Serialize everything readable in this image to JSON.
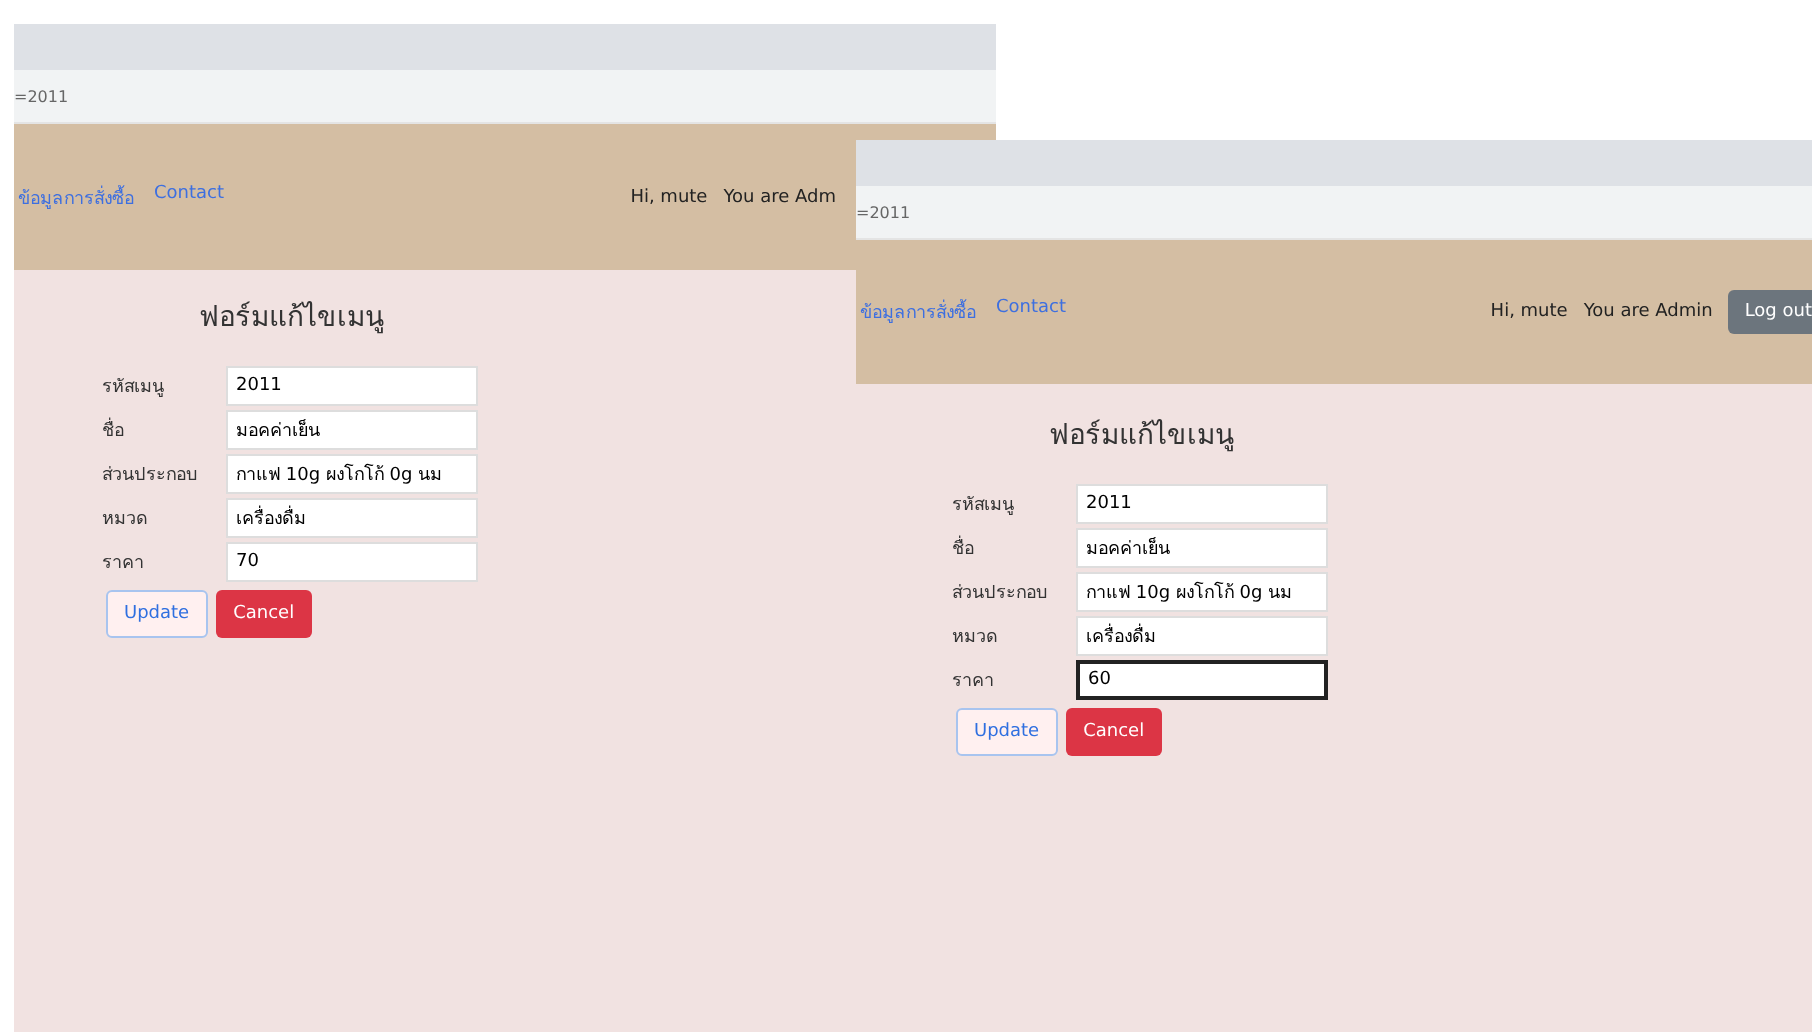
{
  "windows": [
    {
      "address": "=2011",
      "nav_links": [
        "ข้อมูลการสั่งซื้อ",
        "Contact"
      ],
      "greeting": "Hi, mute",
      "role": "You are Adm",
      "form": {
        "title": "ฟอร์มแก้ไขเมนู",
        "fields": [
          {
            "label": "รหัสเมนู",
            "value": "2011",
            "focused": false
          },
          {
            "label": "ชื่อ",
            "value": "มอคค่าเย็น",
            "focused": false
          },
          {
            "label": "ส่วนประกอบ",
            "value": "กาแฟ 10g ผงโกโก้ 0g นม",
            "focused": false
          },
          {
            "label": "หมวด",
            "value": "เครื่องดื่ม",
            "focused": false
          },
          {
            "label": "ราคา",
            "value": "70",
            "focused": false
          }
        ],
        "buttons": [
          {
            "label": "Update",
            "kind": "outline"
          },
          {
            "label": "Cancel",
            "kind": "danger"
          }
        ]
      }
    },
    {
      "address": "=2011",
      "nav_links": [
        "ข้อมูลการสั่งซื้อ",
        "Contact"
      ],
      "greeting": "Hi, mute",
      "role": "You are Admin",
      "logout": "Log out",
      "form": {
        "title": "ฟอร์มแก้ไขเมนู",
        "fields": [
          {
            "label": "รหัสเมนู",
            "value": "2011",
            "focused": false
          },
          {
            "label": "ชื่อ",
            "value": "มอคค่าเย็น",
            "focused": false
          },
          {
            "label": "ส่วนประกอบ",
            "value": "กาแฟ 10g ผงโกโก้ 0g นม",
            "focused": false
          },
          {
            "label": "หมวด",
            "value": "เครื่องดื่ม",
            "focused": false
          },
          {
            "label": "ราคา",
            "value": "60",
            "focused": true
          }
        ],
        "buttons": [
          {
            "label": "Update",
            "kind": "outline"
          },
          {
            "label": "Cancel",
            "kind": "danger"
          }
        ]
      }
    }
  ]
}
